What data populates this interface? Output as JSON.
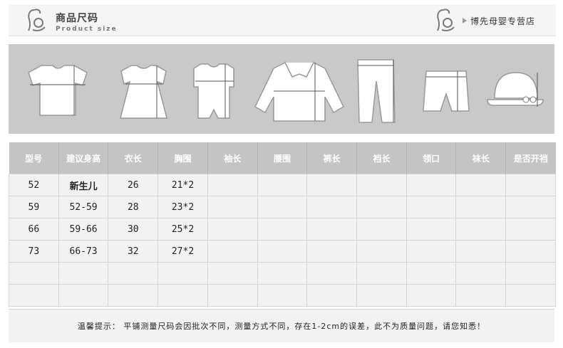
{
  "header": {
    "title": "商品尺码",
    "subtitle": "Product size",
    "store_name": "博先母婴专营店"
  },
  "icons": [
    {
      "name": "tshirt-icon"
    },
    {
      "name": "dress-icon"
    },
    {
      "name": "romper-icon"
    },
    {
      "name": "jacket-icon"
    },
    {
      "name": "pants-icon"
    },
    {
      "name": "shorts-icon"
    },
    {
      "name": "hat-icon"
    }
  ],
  "table": {
    "columns": [
      "型号",
      "建议身高",
      "衣长",
      "胸围",
      "袖长",
      "腰围",
      "裤长",
      "裆长",
      "领口",
      "袜长",
      "是否开裆"
    ],
    "rows": [
      [
        "52",
        "新生儿",
        "26",
        "21*2",
        "",
        "",
        "",
        "",
        "",
        "",
        ""
      ],
      [
        "59",
        "52-59",
        "28",
        "23*2",
        "",
        "",
        "",
        "",
        "",
        "",
        ""
      ],
      [
        "66",
        "59-66",
        "30",
        "25*2",
        "",
        "",
        "",
        "",
        "",
        "",
        ""
      ],
      [
        "73",
        "66-73",
        "32",
        "27*2",
        "",
        "",
        "",
        "",
        "",
        "",
        ""
      ],
      [
        "",
        "",
        "",
        "",
        "",
        "",
        "",
        "",
        "",
        "",
        ""
      ],
      [
        "",
        "",
        "",
        "",
        "",
        "",
        "",
        "",
        "",
        "",
        ""
      ]
    ]
  },
  "footer": {
    "note": "温馨提示：  平铺测量尺码会因批次不同，测量方式不同，存在1-2cm的误差，此不为质量问题，请您知悉！"
  },
  "colors": {
    "band": "#c9c9c9",
    "table_header": "#c4c4c4",
    "cell_bg": "#f2f2f2",
    "garment_fill": "#ffffff"
  }
}
